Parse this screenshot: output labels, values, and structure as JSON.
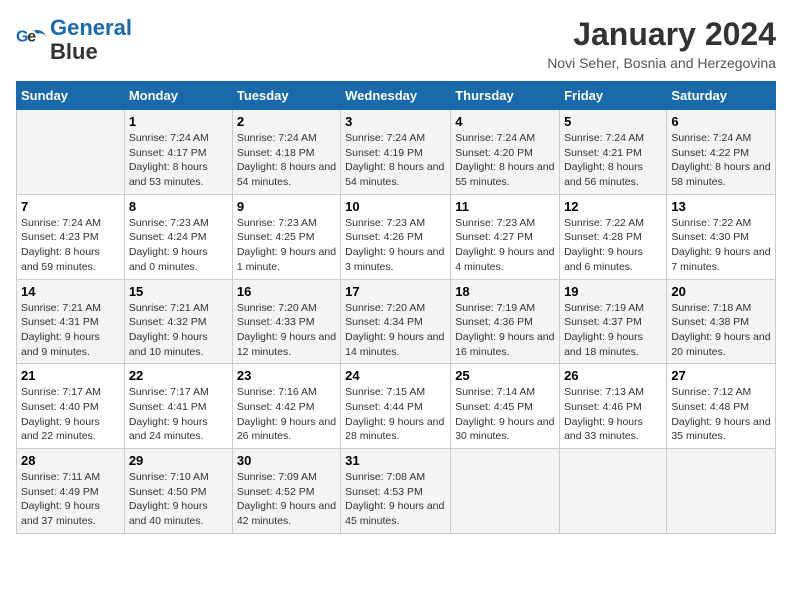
{
  "logo": {
    "line1": "General",
    "line2": "Blue"
  },
  "title": "January 2024",
  "location": "Novi Seher, Bosnia and Herzegovina",
  "days_of_week": [
    "Sunday",
    "Monday",
    "Tuesday",
    "Wednesday",
    "Thursday",
    "Friday",
    "Saturday"
  ],
  "weeks": [
    [
      {
        "day": "",
        "sunrise": "",
        "sunset": "",
        "daylight": ""
      },
      {
        "day": "1",
        "sunrise": "Sunrise: 7:24 AM",
        "sunset": "Sunset: 4:17 PM",
        "daylight": "Daylight: 8 hours and 53 minutes."
      },
      {
        "day": "2",
        "sunrise": "Sunrise: 7:24 AM",
        "sunset": "Sunset: 4:18 PM",
        "daylight": "Daylight: 8 hours and 54 minutes."
      },
      {
        "day": "3",
        "sunrise": "Sunrise: 7:24 AM",
        "sunset": "Sunset: 4:19 PM",
        "daylight": "Daylight: 8 hours and 54 minutes."
      },
      {
        "day": "4",
        "sunrise": "Sunrise: 7:24 AM",
        "sunset": "Sunset: 4:20 PM",
        "daylight": "Daylight: 8 hours and 55 minutes."
      },
      {
        "day": "5",
        "sunrise": "Sunrise: 7:24 AM",
        "sunset": "Sunset: 4:21 PM",
        "daylight": "Daylight: 8 hours and 56 minutes."
      },
      {
        "day": "6",
        "sunrise": "Sunrise: 7:24 AM",
        "sunset": "Sunset: 4:22 PM",
        "daylight": "Daylight: 8 hours and 58 minutes."
      }
    ],
    [
      {
        "day": "7",
        "sunrise": "Sunrise: 7:24 AM",
        "sunset": "Sunset: 4:23 PM",
        "daylight": "Daylight: 8 hours and 59 minutes."
      },
      {
        "day": "8",
        "sunrise": "Sunrise: 7:23 AM",
        "sunset": "Sunset: 4:24 PM",
        "daylight": "Daylight: 9 hours and 0 minutes."
      },
      {
        "day": "9",
        "sunrise": "Sunrise: 7:23 AM",
        "sunset": "Sunset: 4:25 PM",
        "daylight": "Daylight: 9 hours and 1 minute."
      },
      {
        "day": "10",
        "sunrise": "Sunrise: 7:23 AM",
        "sunset": "Sunset: 4:26 PM",
        "daylight": "Daylight: 9 hours and 3 minutes."
      },
      {
        "day": "11",
        "sunrise": "Sunrise: 7:23 AM",
        "sunset": "Sunset: 4:27 PM",
        "daylight": "Daylight: 9 hours and 4 minutes."
      },
      {
        "day": "12",
        "sunrise": "Sunrise: 7:22 AM",
        "sunset": "Sunset: 4:28 PM",
        "daylight": "Daylight: 9 hours and 6 minutes."
      },
      {
        "day": "13",
        "sunrise": "Sunrise: 7:22 AM",
        "sunset": "Sunset: 4:30 PM",
        "daylight": "Daylight: 9 hours and 7 minutes."
      }
    ],
    [
      {
        "day": "14",
        "sunrise": "Sunrise: 7:21 AM",
        "sunset": "Sunset: 4:31 PM",
        "daylight": "Daylight: 9 hours and 9 minutes."
      },
      {
        "day": "15",
        "sunrise": "Sunrise: 7:21 AM",
        "sunset": "Sunset: 4:32 PM",
        "daylight": "Daylight: 9 hours and 10 minutes."
      },
      {
        "day": "16",
        "sunrise": "Sunrise: 7:20 AM",
        "sunset": "Sunset: 4:33 PM",
        "daylight": "Daylight: 9 hours and 12 minutes."
      },
      {
        "day": "17",
        "sunrise": "Sunrise: 7:20 AM",
        "sunset": "Sunset: 4:34 PM",
        "daylight": "Daylight: 9 hours and 14 minutes."
      },
      {
        "day": "18",
        "sunrise": "Sunrise: 7:19 AM",
        "sunset": "Sunset: 4:36 PM",
        "daylight": "Daylight: 9 hours and 16 minutes."
      },
      {
        "day": "19",
        "sunrise": "Sunrise: 7:19 AM",
        "sunset": "Sunset: 4:37 PM",
        "daylight": "Daylight: 9 hours and 18 minutes."
      },
      {
        "day": "20",
        "sunrise": "Sunrise: 7:18 AM",
        "sunset": "Sunset: 4:38 PM",
        "daylight": "Daylight: 9 hours and 20 minutes."
      }
    ],
    [
      {
        "day": "21",
        "sunrise": "Sunrise: 7:17 AM",
        "sunset": "Sunset: 4:40 PM",
        "daylight": "Daylight: 9 hours and 22 minutes."
      },
      {
        "day": "22",
        "sunrise": "Sunrise: 7:17 AM",
        "sunset": "Sunset: 4:41 PM",
        "daylight": "Daylight: 9 hours and 24 minutes."
      },
      {
        "day": "23",
        "sunrise": "Sunrise: 7:16 AM",
        "sunset": "Sunset: 4:42 PM",
        "daylight": "Daylight: 9 hours and 26 minutes."
      },
      {
        "day": "24",
        "sunrise": "Sunrise: 7:15 AM",
        "sunset": "Sunset: 4:44 PM",
        "daylight": "Daylight: 9 hours and 28 minutes."
      },
      {
        "day": "25",
        "sunrise": "Sunrise: 7:14 AM",
        "sunset": "Sunset: 4:45 PM",
        "daylight": "Daylight: 9 hours and 30 minutes."
      },
      {
        "day": "26",
        "sunrise": "Sunrise: 7:13 AM",
        "sunset": "Sunset: 4:46 PM",
        "daylight": "Daylight: 9 hours and 33 minutes."
      },
      {
        "day": "27",
        "sunrise": "Sunrise: 7:12 AM",
        "sunset": "Sunset: 4:48 PM",
        "daylight": "Daylight: 9 hours and 35 minutes."
      }
    ],
    [
      {
        "day": "28",
        "sunrise": "Sunrise: 7:11 AM",
        "sunset": "Sunset: 4:49 PM",
        "daylight": "Daylight: 9 hours and 37 minutes."
      },
      {
        "day": "29",
        "sunrise": "Sunrise: 7:10 AM",
        "sunset": "Sunset: 4:50 PM",
        "daylight": "Daylight: 9 hours and 40 minutes."
      },
      {
        "day": "30",
        "sunrise": "Sunrise: 7:09 AM",
        "sunset": "Sunset: 4:52 PM",
        "daylight": "Daylight: 9 hours and 42 minutes."
      },
      {
        "day": "31",
        "sunrise": "Sunrise: 7:08 AM",
        "sunset": "Sunset: 4:53 PM",
        "daylight": "Daylight: 9 hours and 45 minutes."
      },
      {
        "day": "",
        "sunrise": "",
        "sunset": "",
        "daylight": ""
      },
      {
        "day": "",
        "sunrise": "",
        "sunset": "",
        "daylight": ""
      },
      {
        "day": "",
        "sunrise": "",
        "sunset": "",
        "daylight": ""
      }
    ]
  ]
}
